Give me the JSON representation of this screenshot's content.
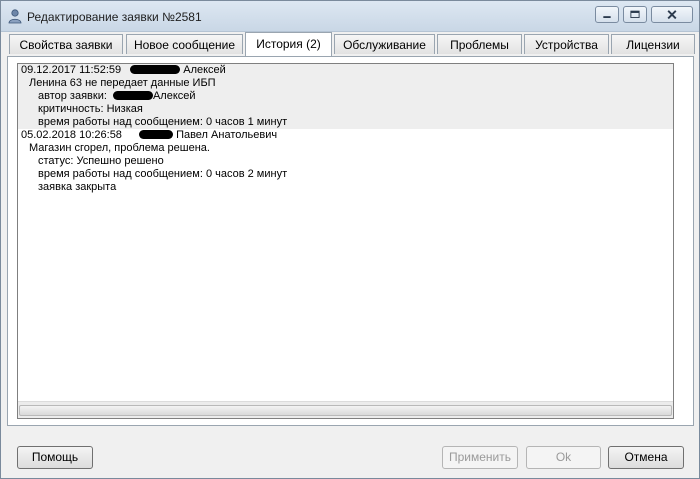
{
  "window": {
    "title": "Редактирование заявки №2581"
  },
  "tabs": [
    {
      "label": "Свойства заявки"
    },
    {
      "label": "Новое сообщение"
    },
    {
      "label": "История (2)"
    },
    {
      "label": "Обслуживание"
    },
    {
      "label": "Проблемы"
    },
    {
      "label": "Устройства"
    },
    {
      "label": "Лицензии"
    }
  ],
  "active_tab": "История (2)",
  "history": [
    {
      "datetime": "09.12.2017 11:52:59",
      "author": "Алексей",
      "message": "Ленина 63 не передает данные ИБП",
      "details": [
        {
          "label": "автор заявки:",
          "value": "Алексей"
        },
        {
          "label": "критичность:",
          "value": "Низкая"
        },
        {
          "label": "время работы над сообщением:",
          "value": "0 часов 1 минут"
        }
      ]
    },
    {
      "datetime": "05.02.2018 10:26:58",
      "author": "Павел Анатольевич",
      "message": "Магазин сгорел, проблема решена.",
      "details": [
        {
          "label": "статус:",
          "value": "Успешно решено"
        },
        {
          "label": "время работы над сообщением:",
          "value": "0 часов 2 минут"
        },
        {
          "label": "",
          "value": "заявка закрыта"
        }
      ]
    }
  ],
  "buttons": {
    "help": "Помощь",
    "apply": "Применить",
    "ok": "Ok",
    "cancel": "Отмена"
  }
}
